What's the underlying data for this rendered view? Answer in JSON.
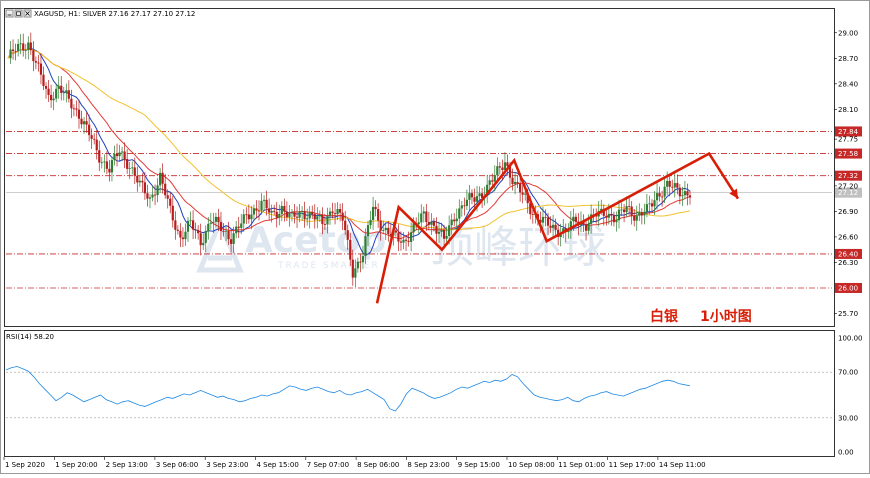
{
  "header": {
    "symbol_info": "XAGUSD, H1:  SILVER  27.16 27.17 27.10 27.12",
    "window_buttons": [
      "minimize-icon",
      "restore-icon",
      "close-icon"
    ]
  },
  "watermark": {
    "brand": "Acetop",
    "tagline": "TRADE SMARTER",
    "cn_brand": "顶峰环球"
  },
  "annotation": {
    "label_main": "白银",
    "label_tf": "1小时图"
  },
  "colors": {
    "candle_up": "#2e7d32",
    "candle_down": "#b71c1c",
    "ma_fast": "#1f3fbf",
    "ma_mid": "#e53935",
    "ma_slow": "#f2c12e",
    "level_line": "#c62828",
    "arrow": "#d81e06",
    "rsi_line": "#1e88e5",
    "current_price_box": "#c0c0c0"
  },
  "chart_data": [
    {
      "type": "candlestick",
      "title": "XAGUSD, H1: SILVER 27.16 27.17 27.10 27.12",
      "y_ticks": [
        "29.00",
        "28.70",
        "28.40",
        "28.10",
        "27.75",
        "27.20",
        "26.90",
        "26.60",
        "26.30",
        "25.70"
      ],
      "ylim": [
        25.6,
        29.15
      ],
      "x_ticks": [
        "1 Sep 2020",
        "1 Sep 20:00",
        "2 Sep 13:00",
        "3 Sep 06:00",
        "3 Sep 23:00",
        "4 Sep 15:00",
        "7 Sep 07:00",
        "8 Sep 06:00",
        "8 Sep 23:00",
        "9 Sep 15:00",
        "10 Sep 08:00",
        "11 Sep 01:00",
        "11 Sep 17:00",
        "14 Sep 11:00"
      ],
      "horizontal_levels": [
        {
          "value": 27.84,
          "label": "27.84"
        },
        {
          "value": 27.58,
          "label": "27.58"
        },
        {
          "value": 27.32,
          "label": "27.32"
        },
        {
          "value": 26.4,
          "label": "26.40"
        },
        {
          "value": 26.0,
          "label": "26.00"
        }
      ],
      "current_price": {
        "value": 27.12,
        "label": "27.12"
      },
      "close_path": [
        [
          0,
          28.7
        ],
        [
          4,
          28.82
        ],
        [
          8,
          28.88
        ],
        [
          12,
          28.55
        ],
        [
          16,
          28.25
        ],
        [
          20,
          28.35
        ],
        [
          24,
          28.2
        ],
        [
          28,
          28.05
        ],
        [
          32,
          27.8
        ],
        [
          36,
          27.55
        ],
        [
          40,
          27.4
        ],
        [
          44,
          27.6
        ],
        [
          48,
          27.45
        ],
        [
          52,
          27.2
        ],
        [
          56,
          27.05
        ],
        [
          60,
          27.3
        ],
        [
          64,
          26.9
        ],
        [
          68,
          26.6
        ],
        [
          72,
          26.75
        ],
        [
          76,
          26.55
        ],
        [
          80,
          26.8
        ],
        [
          84,
          26.7
        ],
        [
          88,
          26.6
        ],
        [
          92,
          26.75
        ],
        [
          96,
          26.9
        ],
        [
          100,
          27.0
        ],
        [
          104,
          26.85
        ],
        [
          108,
          26.95
        ],
        [
          112,
          26.8
        ],
        [
          116,
          26.9
        ],
        [
          120,
          26.85
        ],
        [
          124,
          26.75
        ],
        [
          128,
          26.95
        ],
        [
          132,
          26.8
        ],
        [
          136,
          26.2
        ],
        [
          140,
          26.4
        ],
        [
          144,
          26.95
        ],
        [
          148,
          26.7
        ],
        [
          152,
          26.6
        ],
        [
          156,
          26.55
        ],
        [
          160,
          26.7
        ],
        [
          164,
          26.85
        ],
        [
          168,
          26.75
        ],
        [
          172,
          26.55
        ],
        [
          176,
          26.85
        ],
        [
          180,
          27.0
        ],
        [
          184,
          27.05
        ],
        [
          188,
          27.15
        ],
        [
          192,
          27.3
        ],
        [
          196,
          27.5
        ],
        [
          200,
          27.2
        ],
        [
          204,
          27.05
        ],
        [
          208,
          26.85
        ],
        [
          212,
          26.75
        ],
        [
          216,
          26.7
        ],
        [
          220,
          26.65
        ],
        [
          224,
          26.8
        ],
        [
          228,
          26.75
        ],
        [
          232,
          26.85
        ],
        [
          236,
          26.9
        ],
        [
          240,
          26.8
        ],
        [
          244,
          26.95
        ],
        [
          248,
          26.85
        ],
        [
          252,
          26.9
        ],
        [
          256,
          27.1
        ],
        [
          260,
          27.2
        ],
        [
          264,
          27.15
        ],
        [
          268,
          27.12
        ]
      ],
      "bars_total": 270,
      "moving_averages": [
        {
          "color_key": "ma_fast",
          "period": 9
        },
        {
          "color_key": "ma_mid",
          "period": 21
        },
        {
          "color_key": "ma_slow",
          "period": 55
        }
      ],
      "red_arrow_path": [
        [
          0.0,
          25.82
        ],
        [
          0.06,
          26.95
        ],
        [
          0.18,
          26.45
        ],
        [
          0.38,
          27.5
        ],
        [
          0.47,
          26.55
        ],
        [
          0.92,
          27.58
        ],
        [
          1.0,
          27.05
        ]
      ]
    },
    {
      "type": "line",
      "title": "RSI(14) 58.20",
      "y_ticks": [
        "100.00",
        "70.00",
        "30.00",
        "0.00"
      ],
      "ylim": [
        0,
        100
      ],
      "levels": [
        70,
        30
      ],
      "values": [
        72,
        74,
        75,
        73,
        71,
        66,
        60,
        55,
        50,
        45,
        48,
        52,
        50,
        47,
        44,
        46,
        48,
        50,
        46,
        44,
        42,
        44,
        45,
        43,
        41,
        40,
        42,
        44,
        46,
        48,
        47,
        49,
        51,
        50,
        52,
        54,
        52,
        50,
        48,
        49,
        47,
        46,
        44,
        45,
        47,
        48,
        50,
        49,
        51,
        52,
        55,
        58,
        57,
        55,
        54,
        56,
        57,
        55,
        53,
        52,
        54,
        51,
        50,
        52,
        53,
        55,
        52,
        49,
        46,
        38,
        36,
        42,
        51,
        56,
        54,
        52,
        49,
        47,
        48,
        50,
        52,
        55,
        57,
        56,
        58,
        60,
        62,
        61,
        63,
        62,
        64,
        68,
        66,
        60,
        55,
        50,
        48,
        47,
        46,
        45,
        46,
        48,
        45,
        44,
        47,
        49,
        50,
        52,
        53,
        51,
        50,
        49,
        51,
        53,
        55,
        56,
        58,
        60,
        62,
        63,
        62,
        60,
        59,
        58
      ]
    }
  ]
}
